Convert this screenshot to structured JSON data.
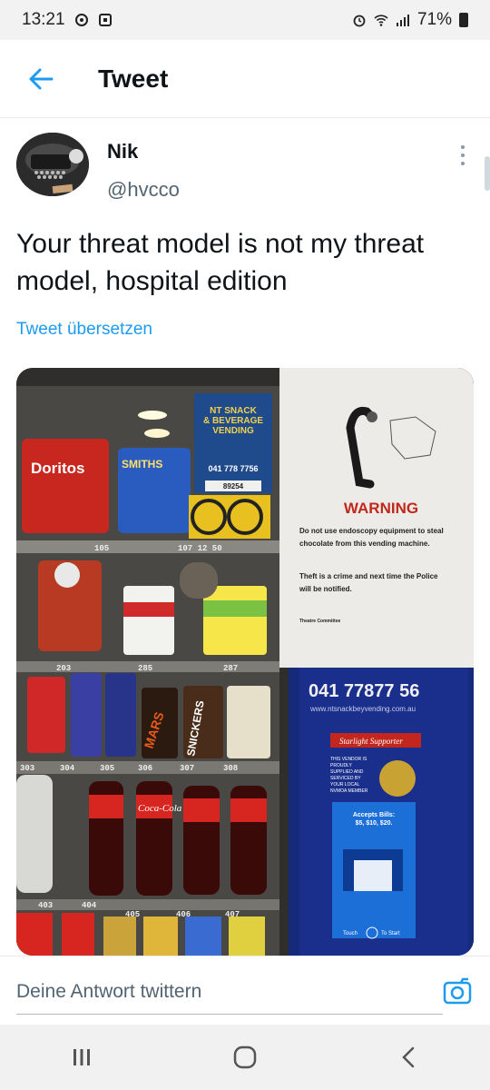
{
  "status_bar": {
    "time": "13:21",
    "battery": "71%",
    "left_icons": [
      "notification-icon",
      "app-icon"
    ],
    "right_icons": [
      "alarm-icon",
      "wifi-icon",
      "signal-icon",
      "battery-icon"
    ]
  },
  "header": {
    "title": "Tweet",
    "back_icon": "arrow-left-icon",
    "accent": "#1d9bf0"
  },
  "tweet": {
    "author_name": "Nik",
    "author_handle": "@hvcco",
    "text": "Your threat model is not my threat model, hospital edition",
    "translate_label": "Tweet übersetzen"
  },
  "photo": {
    "sign_top": [
      "NT SNACK",
      "& BEVERAGE",
      "VENDING"
    ],
    "sign_phone_small": "041 778 7756",
    "sign_code": "89254",
    "warning_title": "WARNING",
    "warning_line1": "Do not use endoscopy equipment to steal",
    "warning_line2": "chocolate from this vending machine.",
    "warning_line3": "Theft is a crime and next time the Police",
    "warning_line4": "will be notified.",
    "warning_sign": "Theatre Committee",
    "phone_big": "041 77877 56",
    "website": "www.ntsnackbeyvending.com.au",
    "supporter": "Starlight Supporter",
    "vendor_text": [
      "THIS VENDOR IS",
      "PROUDLY",
      "SUPPLIED AND",
      "SERVICED BY",
      "YOUR LOCAL",
      "NVMOA MEMBER"
    ],
    "accepts": [
      "Accepts Bills:",
      "$5, $10, $20."
    ],
    "touch": "Touch",
    "to_start": "To Start",
    "brand_doritos": "Doritos",
    "brand_smiths": "SMITHS",
    "brand_mars": "MARS",
    "brand_snickers": "SNICKERS",
    "brand_cola": "Coca-Cola",
    "slot_labels": [
      "105",
      "107 12 50",
      "203",
      "285",
      "287",
      "303",
      "304",
      "305",
      "306",
      "307",
      "308",
      "403",
      "404",
      "405",
      "406",
      "407"
    ]
  },
  "reply": {
    "placeholder": "Deine Antwort twittern",
    "camera_icon": "camera-icon"
  },
  "nav": {
    "recents_icon": "recents-icon",
    "home_icon": "home-icon",
    "back_icon": "back-chevron-icon"
  }
}
